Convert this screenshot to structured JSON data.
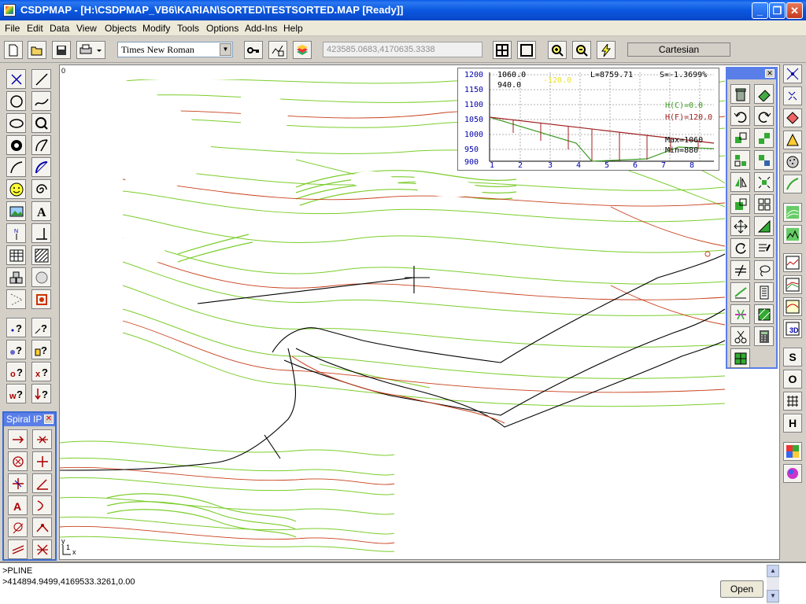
{
  "window": {
    "title": "CSDPMAP - [H:\\CSDPMAP_VB6\\KARIAN\\SORTED\\TESTSORTED.MAP [Ready]]",
    "minimize": "_",
    "restore": "❐",
    "close": "✕"
  },
  "menu": [
    "File",
    "Edit",
    "Data",
    "View",
    "Objects",
    "Modify",
    "Tools",
    "Options",
    "Add-Ins",
    "Help"
  ],
  "toolbar": {
    "font": "Times New Roman",
    "coords": "423585.0683,4170635.3338",
    "mode": "Cartesian"
  },
  "canvas": {
    "origin_label": "0",
    "axis_y": "y",
    "axis_x": "x",
    "axis_1": "1"
  },
  "profile": {
    "y_ticks": [
      "1200",
      "1150",
      "1100",
      "1050",
      "1000",
      "950",
      "900"
    ],
    "x_ticks": [
      "1",
      "2",
      "3",
      "4",
      "5",
      "6",
      "7",
      "8"
    ],
    "top_left_1": "1060.0",
    "top_left_2": "940.0",
    "marker": "-120.0",
    "length": "L=8759.71",
    "slope": "S=-1.3699%",
    "hc": "H(C)=0.0",
    "hf": "H(F)=120.0",
    "max": "Max=1060",
    "min": "Min=880"
  },
  "spiral_palette": {
    "title": "Spiral IP",
    "close": "✕"
  },
  "float_palette": {
    "close": "✕"
  },
  "rightbar": {
    "s": "S",
    "o": "O",
    "h": "H"
  },
  "command": {
    "line1": ">PLINE",
    "line2": ">414894.9499,4169533.3261,0.00",
    "open": "Open"
  },
  "colors": {
    "contour_green": "#7ccd2c",
    "contour_red": "#c8401c",
    "titlebar": "#0a5ae8"
  }
}
